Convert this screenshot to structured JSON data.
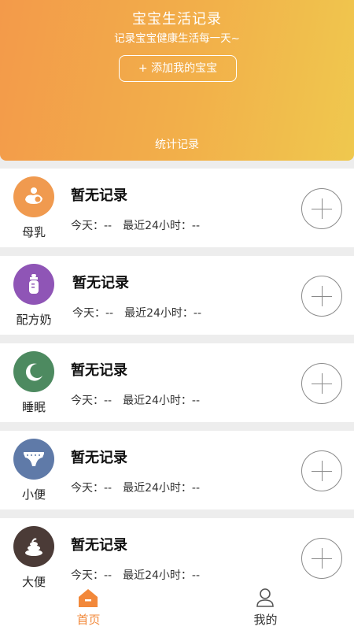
{
  "header": {
    "title": "宝宝生活记录",
    "subtitle": "记录宝宝健康生活每一天~",
    "add_button": "+ 添加我的宝宝",
    "stats_link": "统计记录"
  },
  "records": [
    {
      "category": "母乳",
      "icon": "breastfeeding-icon",
      "color": "#f09a4f",
      "status": "暂无记录",
      "today": "今天：--",
      "last24h": "最近24小时：--"
    },
    {
      "category": "配方奶",
      "icon": "baby-bottle-icon",
      "color": "#8f55b6",
      "status": "暂无记录",
      "today": "今天：--",
      "last24h": "最近24小时：--"
    },
    {
      "category": "睡眠",
      "icon": "moon-icon",
      "color": "#4d8a60",
      "status": "暂无记录",
      "today": "今天：--",
      "last24h": "最近24小时：--"
    },
    {
      "category": "小便",
      "icon": "diaper-icon",
      "color": "#5f7aa8",
      "status": "暂无记录",
      "today": "今天：--",
      "last24h": "最近24小时：--"
    },
    {
      "category": "大便",
      "icon": "poop-icon",
      "color": "#4b3b37",
      "status": "暂无记录",
      "today": "今天：--",
      "last24h": "最近24小时：--"
    }
  ],
  "tabbar": {
    "home": {
      "label": "首页",
      "icon": "home-icon",
      "active_color": "#f2883a"
    },
    "mine": {
      "label": "我的",
      "icon": "profile-icon",
      "color": "#333333"
    }
  }
}
